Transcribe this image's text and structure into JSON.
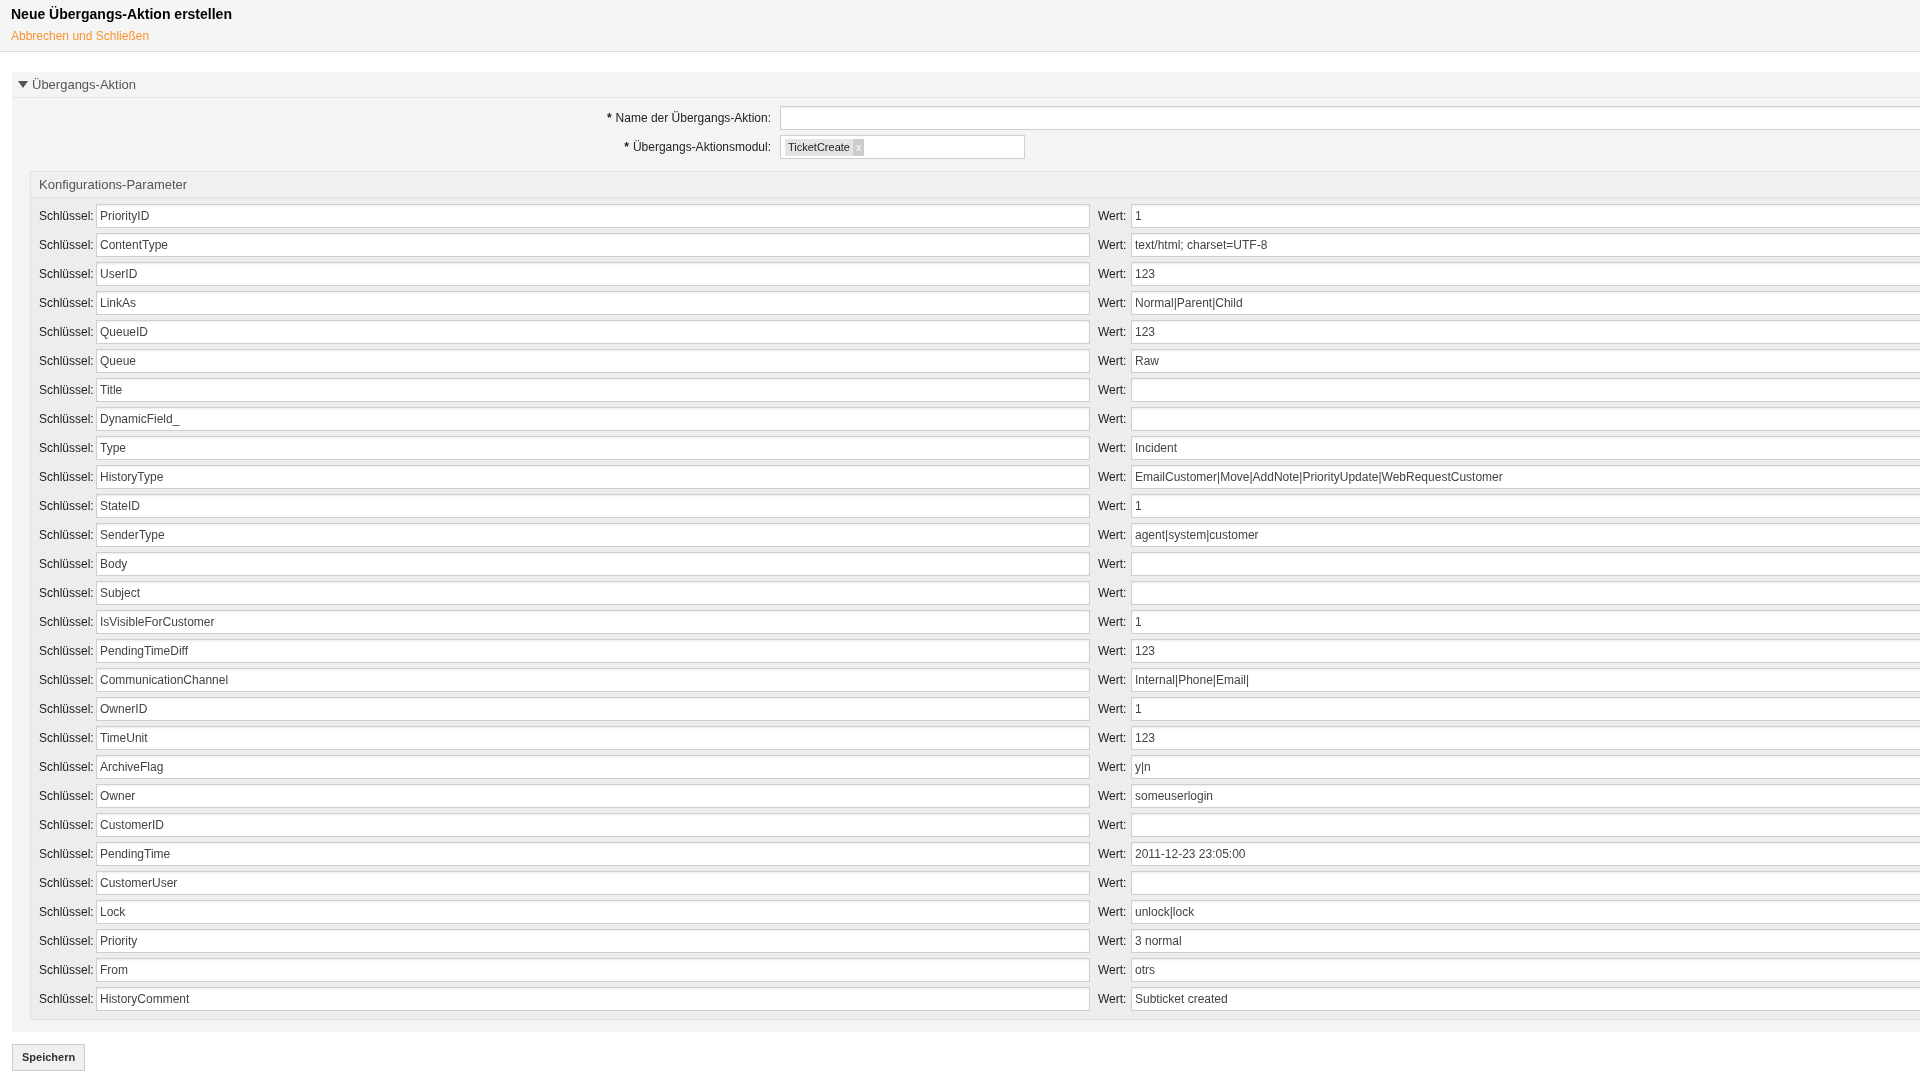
{
  "header": {
    "title": "Neue Übergangs-Aktion erstellen",
    "link": "Abbrechen und Schließen"
  },
  "section": {
    "title": "Übergangs-Aktion",
    "expanded": true,
    "fields": [
      {
        "kind": "text",
        "marker": "*",
        "label": "Name der Übergangs-Aktion:"
      },
      {
        "kind": "tags",
        "marker": "*",
        "label": "Übergangs-Aktionsmodul:",
        "tags": [
          {
            "label": "TicketCreate",
            "remove": "x"
          }
        ]
      }
    ],
    "config": {
      "title": "Konfigurations-Parameter",
      "rows": [
        {
          "key_label": "Schlüssel:",
          "key": "PriorityID",
          "value_label": "Wert:",
          "value": "1"
        },
        {
          "key_label": "Schlüssel:",
          "key": "ContentType",
          "value_label": "Wert:",
          "value": "text/html; charset=UTF-8"
        },
        {
          "key_label": "Schlüssel:",
          "key": "UserID",
          "value_label": "Wert:",
          "value": "123"
        },
        {
          "key_label": "Schlüssel:",
          "key": "LinkAs",
          "value_label": "Wert:",
          "value": "Normal|Parent|Child"
        },
        {
          "key_label": "Schlüssel:",
          "key": "QueueID",
          "value_label": "Wert:",
          "value": "123"
        },
        {
          "key_label": "Schlüssel:",
          "key": "Queue",
          "value_label": "Wert:",
          "value": "Raw"
        },
        {
          "key_label": "Schlüssel:",
          "key": "Title",
          "value_label": "Wert:"
        },
        {
          "key_label": "Schlüssel:",
          "key": "DynamicField_",
          "value_label": "Wert:"
        },
        {
          "key_label": "Schlüssel:",
          "key": "Type",
          "value_label": "Wert:",
          "value": "Incident"
        },
        {
          "key_label": "Schlüssel:",
          "key": "HistoryType",
          "value_label": "Wert:",
          "value": "EmailCustomer|Move|AddNote|PriorityUpdate|WebRequestCustomer"
        },
        {
          "key_label": "Schlüssel:",
          "key": "StateID",
          "value_label": "Wert:",
          "value": "1"
        },
        {
          "key_label": "Schlüssel:",
          "key": "SenderType",
          "value_label": "Wert:",
          "value": "agent|system|customer"
        },
        {
          "key_label": "Schlüssel:",
          "key": "Body",
          "value_label": "Wert:"
        },
        {
          "key_label": "Schlüssel:",
          "key": "Subject",
          "value_label": "Wert:"
        },
        {
          "key_label": "Schlüssel:",
          "key": "IsVisibleForCustomer",
          "value_label": "Wert:",
          "value": "1"
        },
        {
          "key_label": "Schlüssel:",
          "key": "PendingTimeDiff",
          "value_label": "Wert:",
          "value": "123"
        },
        {
          "key_label": "Schlüssel:",
          "key": "CommunicationChannel",
          "value_label": "Wert:",
          "value": "Internal|Phone|Email|"
        },
        {
          "key_label": "Schlüssel:",
          "key": "OwnerID",
          "value_label": "Wert:",
          "value": "1"
        },
        {
          "key_label": "Schlüssel:",
          "key": "TimeUnit",
          "value_label": "Wert:",
          "value": "123"
        },
        {
          "key_label": "Schlüssel:",
          "key": "ArchiveFlag",
          "value_label": "Wert:",
          "value": "y|n"
        },
        {
          "key_label": "Schlüssel:",
          "key": "Owner",
          "value_label": "Wert:",
          "value": "someuserlogin"
        },
        {
          "key_label": "Schlüssel:",
          "key": "CustomerID",
          "value_label": "Wert:"
        },
        {
          "key_label": "Schlüssel:",
          "key": "PendingTime",
          "value_label": "Wert:",
          "value": "2011-12-23 23:05:00"
        },
        {
          "key_label": "Schlüssel:",
          "key": "CustomerUser",
          "value_label": "Wert:"
        },
        {
          "key_label": "Schlüssel:",
          "key": "Lock",
          "value_label": "Wert:",
          "value": "unlock|lock"
        },
        {
          "key_label": "Schlüssel:",
          "key": "Priority",
          "value_label": "Wert:",
          "value": "3 normal"
        },
        {
          "key_label": "Schlüssel:",
          "key": "From",
          "value_label": "Wert:",
          "value": "otrs"
        },
        {
          "key_label": "Schlüssel:",
          "key": "HistoryComment",
          "value_label": "Wert:",
          "value": "Subticket created"
        }
      ]
    }
  },
  "buttons": [
    {
      "label": "Speichern"
    }
  ]
}
